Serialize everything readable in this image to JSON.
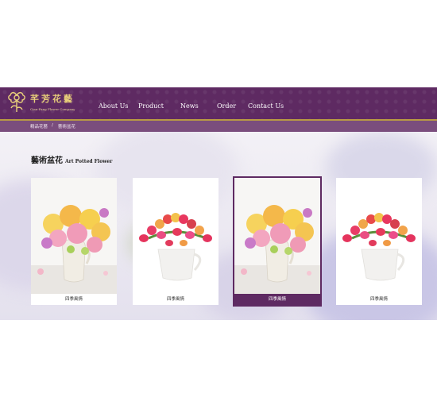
{
  "brand": {
    "name_cn": "芊芳花藝",
    "name_en": "Cian-Fang Flower Company",
    "icon": "flower-logo-icon"
  },
  "nav": {
    "items": [
      {
        "label": "About Us"
      },
      {
        "label": "Product"
      },
      {
        "label": "News"
      },
      {
        "label": "Order"
      },
      {
        "label": "Contact Us"
      }
    ]
  },
  "breadcrumb": {
    "items": [
      "精品花藝",
      "藝術盆花"
    ],
    "separator": "/"
  },
  "page": {
    "title_cn": "藝術盆花",
    "title_en": "Art Potted Flower"
  },
  "products": [
    {
      "caption": "四季風情",
      "image": "rose-bouquet-vase"
    },
    {
      "caption": "四季風情",
      "image": "tulip-pitcher"
    },
    {
      "caption": "四季風情",
      "image": "rose-bouquet-vase",
      "active": true
    },
    {
      "caption": "四季風情",
      "image": "tulip-pitcher"
    }
  ],
  "colors": {
    "header": "#5e2a62",
    "accent_gold": "#b89a43",
    "breadcrumb_bar": "#7a4d7d"
  }
}
